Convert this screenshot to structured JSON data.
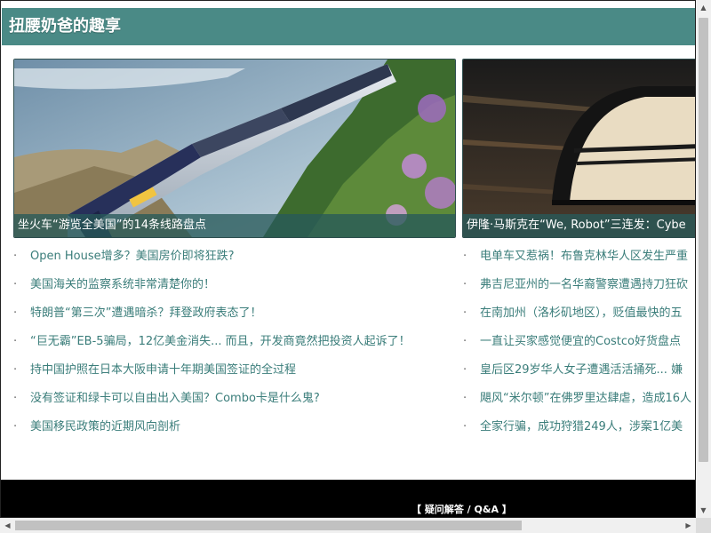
{
  "header": {
    "title": "扭腰奶爸的趣享"
  },
  "featured": [
    {
      "caption": "坐火车“游览全美国”的14条线路盘点"
    },
    {
      "caption": "伊隆·马斯克在“We, Robot”三连发：Cybe"
    }
  ],
  "list_left": [
    "Open House增多？美国房价即将狂跌?",
    "美国海关的监察系统非常清楚你的！",
    "特朗普“第三次”遭遇暗杀？拜登政府表态了！",
    "“巨无霸”EB-5骗局，12亿美金消失... 而且，开发商竟然把投资人起诉了！",
    "持中国护照在日本大阪申请十年期美国签证的全过程",
    "没有签证和绿卡可以自由出入美国？Combo卡是什么鬼?",
    "美国移民政策的近期风向剖析"
  ],
  "list_right": [
    "电单车又惹祸！布鲁克林华人区发生严重",
    "弗吉尼亚州的一名华裔警察遭遇持刀狂砍",
    "在南加州（洛杉矶地区），贬值最快的五",
    "一直让买家感觉便宜的Costco好货盘点",
    "皇后区29岁华人女子遭遇活活捅死... 嫌",
    "飓风“米尔顿”在佛罗里达肆虐，造成16人",
    "全家行骗，成功狩猎249人，涉案1亿美"
  ],
  "bullet": "·",
  "footer": {
    "link": "【 疑问解答 / Q&A 】"
  },
  "colors": {
    "header_bg": "#4a8a86",
    "link": "#3a7d7a",
    "footer_bg": "#000000"
  }
}
